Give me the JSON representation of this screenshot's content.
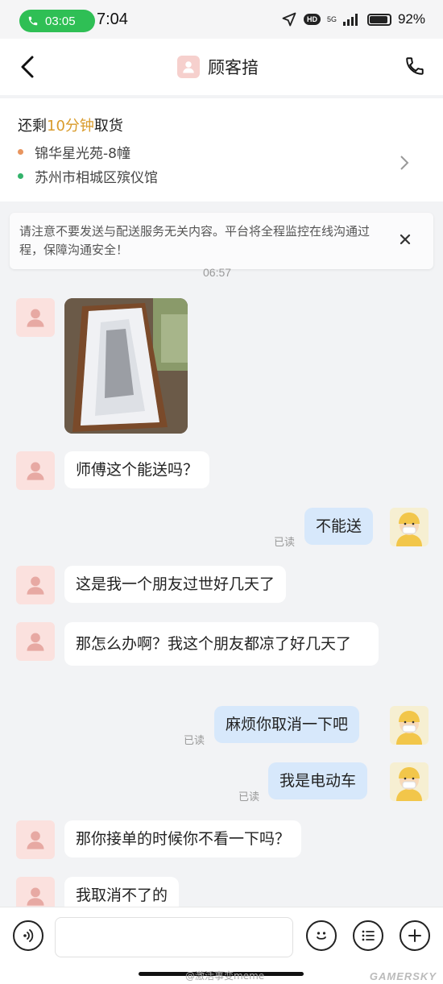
{
  "status_bar": {
    "call_time": "03:05",
    "time": "7:04",
    "network": "5G",
    "hd": "HD",
    "battery": "92%",
    "battery_level": 0.92
  },
  "header": {
    "title": "顾客揞"
  },
  "order": {
    "remaining_prefix": "还剩",
    "remaining_highlight": "10分钟",
    "remaining_suffix": "取货",
    "pickup_address": "锦华星光苑-8幢",
    "dropoff_address": "苏州市相城区殡仪馆",
    "pickup_color": "#e8955f",
    "dropoff_color": "#33b36b"
  },
  "notice": {
    "text": "请注意不要发送与配送服务无关内容。平台将全程监控在线沟通过程，保障沟通安全！"
  },
  "chat": {
    "timestamp": "06:57",
    "messages": [
      {
        "side": "customer",
        "type": "image"
      },
      {
        "side": "customer",
        "text": "师傅这个能送吗？"
      },
      {
        "side": "me",
        "text": "不能送",
        "status": "已读"
      },
      {
        "side": "customer",
        "text": "这是我一个朋友过世好几天了"
      },
      {
        "side": "customer",
        "text": "那怎么办啊？我这个朋友都凉了好几天了"
      },
      {
        "side": "me",
        "text": "麻烦你取消一下吧",
        "status": "已读"
      },
      {
        "side": "me",
        "text": "我是电动车",
        "status": "已读"
      },
      {
        "side": "customer",
        "text": "那你接单的时候你不看一下吗？"
      },
      {
        "side": "customer",
        "text": "我取消不了的"
      }
    ]
  },
  "bottom": {
    "watermark": "@激活事变meme",
    "brand": "GAMERSKY"
  },
  "colors": {
    "accent_highlight": "#d99b2b",
    "my_bubble": "#d7e8fb",
    "call_pill": "#2fbf55"
  }
}
